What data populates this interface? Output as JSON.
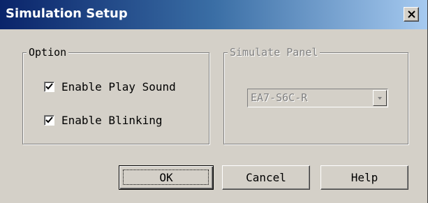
{
  "window": {
    "title": "Simulation Setup",
    "close_glyph": "close-icon"
  },
  "option_group": {
    "label": "Option",
    "play_sound": {
      "label": "Enable Play Sound",
      "checked": true
    },
    "blinking": {
      "label": "Enable Blinking",
      "checked": true
    }
  },
  "simulate_panel": {
    "label": "Simulate Panel",
    "enabled": false,
    "selected": "EA7-S6C-R"
  },
  "buttons": {
    "ok": "OK",
    "cancel": "Cancel",
    "help": "Help"
  },
  "colors": {
    "title_start": "#0a246a",
    "title_end": "#a6caf0",
    "face": "#d4d0c8"
  }
}
